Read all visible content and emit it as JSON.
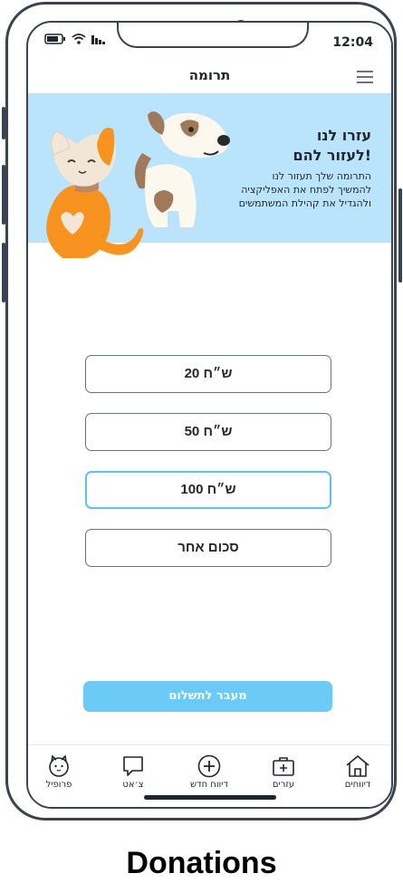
{
  "status": {
    "time": "12:04"
  },
  "header": {
    "title": "תרומה"
  },
  "banner": {
    "title_line1": "עזרו לנו",
    "title_line2": "לעזור להם!",
    "text_line1": "התרומה שלך תעזור לנו",
    "text_line2": "להמשיך לפתח את האפליקציה",
    "text_line3": "ולהגדיל את קהילת המשתמשים"
  },
  "amounts": [
    {
      "label": "20 ש״ח",
      "selected": false
    },
    {
      "label": "50 ש״ח",
      "selected": false
    },
    {
      "label": "100 ש״ח",
      "selected": true
    },
    {
      "label": "סכום אחר",
      "selected": false
    }
  ],
  "pay_button": {
    "label": "מעבר לתשלום"
  },
  "tabs": [
    {
      "label": "פרופיל",
      "icon": "cat-face-icon"
    },
    {
      "label": "צ׳אט",
      "icon": "chat-icon"
    },
    {
      "label": "דיווח חדש",
      "icon": "plus-circle-icon"
    },
    {
      "label": "עזרים",
      "icon": "first-aid-icon"
    },
    {
      "label": "דיווחים",
      "icon": "home-icon"
    }
  ],
  "caption": "Donations",
  "colors": {
    "accent": "#5bc2f2",
    "banner": "#b9e4fb",
    "pay_button": "#6ccaf7"
  }
}
